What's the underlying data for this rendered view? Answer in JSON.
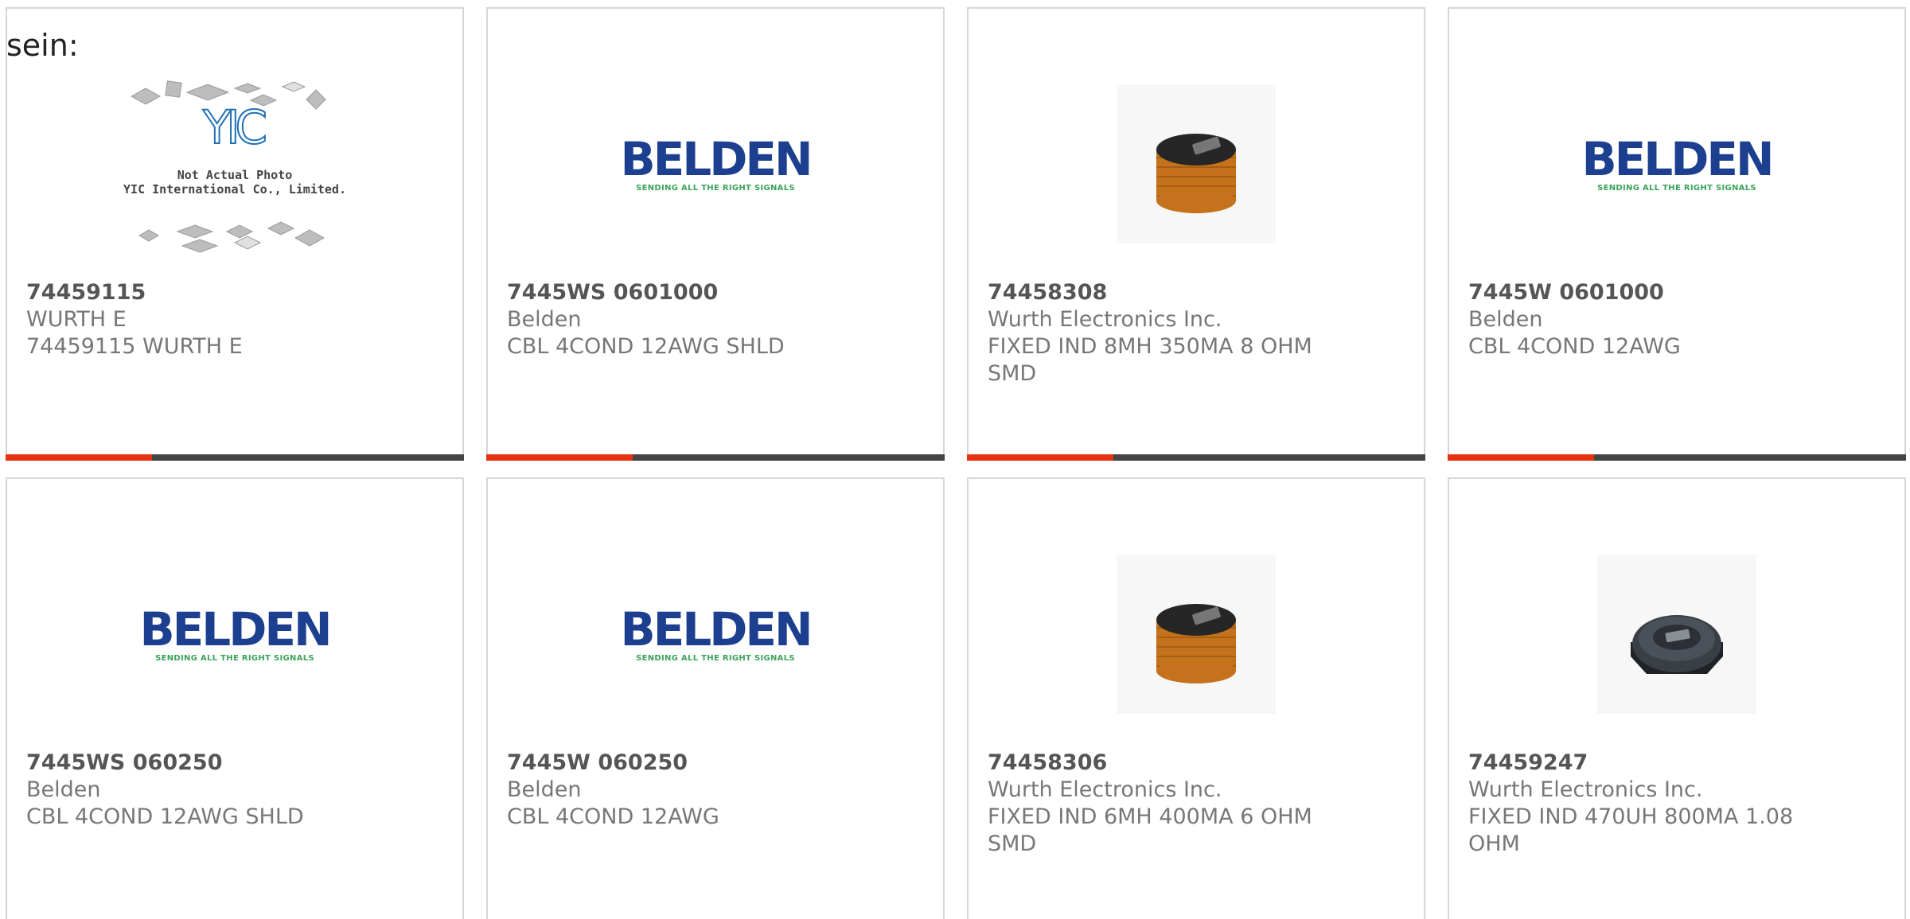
{
  "prefix_text": "sein:",
  "products": [
    {
      "part_number": "74459115",
      "manufacturer": "WURTH E",
      "description": "74459115 WURTH E",
      "image": "yic-placeholder",
      "image_caption_line1": "Not Actual Photo",
      "image_caption_line2": "YIC International Co., Limited.",
      "logo_text": "YIC"
    },
    {
      "part_number": "7445WS 0601000",
      "manufacturer": "Belden",
      "description": "CBL 4COND 12AWG SHLD",
      "image": "belden-logo",
      "logo_text": "BELDEN",
      "logo_tagline": "SENDING ALL THE RIGHT SIGNALS"
    },
    {
      "part_number": "74458308",
      "manufacturer": "Wurth Electronics Inc.",
      "description": "FIXED IND 8MH 350MA 8 OHM SMD",
      "image": "copper-inductor-photo"
    },
    {
      "part_number": "7445W 0601000",
      "manufacturer": "Belden",
      "description": "CBL 4COND 12AWG",
      "image": "belden-logo",
      "logo_text": "BELDEN",
      "logo_tagline": "SENDING ALL THE RIGHT SIGNALS"
    },
    {
      "part_number": "7445WS 060250",
      "manufacturer": "Belden",
      "description": "CBL 4COND 12AWG SHLD",
      "image": "belden-logo",
      "logo_text": "BELDEN",
      "logo_tagline": "SENDING ALL THE RIGHT SIGNALS"
    },
    {
      "part_number": "7445W 060250",
      "manufacturer": "Belden",
      "description": "CBL 4COND 12AWG",
      "image": "belden-logo",
      "logo_text": "BELDEN",
      "logo_tagline": "SENDING ALL THE RIGHT SIGNALS"
    },
    {
      "part_number": "74458306",
      "manufacturer": "Wurth Electronics Inc.",
      "description": "FIXED IND 6MH 400MA 6 OHM SMD",
      "image": "copper-inductor-photo"
    },
    {
      "part_number": "74459247",
      "manufacturer": "Wurth Electronics Inc.",
      "description": "FIXED IND 470UH 800MA 1.08 OHM",
      "image": "shielded-inductor-photo"
    }
  ],
  "colors": {
    "accent_bar": "#e63312",
    "bar_base": "#444444",
    "belden_blue": "#1c3f8f",
    "belden_green": "#3aa35a",
    "yic_blue": "#1f6fb5",
    "card_border": "#d6d6d6"
  }
}
